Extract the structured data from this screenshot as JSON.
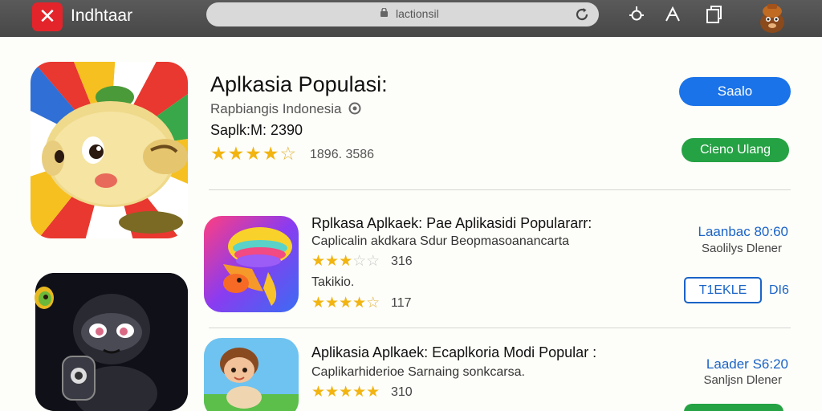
{
  "topbar": {
    "logo_glyph": "✕",
    "app_title": "Indhtaar",
    "url": "lactionsil"
  },
  "featured": {
    "title": "Aplkasia Populasi:",
    "subtitle": "Rapbiangis Indonesia",
    "size_text": "Saplk:M: 2390",
    "rating_stars": "★★★★",
    "rating_partial": "☆",
    "rating_count": "1896. 3586",
    "primary_button": "Saalo",
    "secondary_button": "Cieno Ulang"
  },
  "rows": [
    {
      "title": "Rplkasa Aplkaek: Pae Aplikasidi Populararr:",
      "subtitle": "Caplicalin akdkara Sdur Beopmasoanancarta",
      "stars": "★★★",
      "stars_empty": "☆☆",
      "rating": "316",
      "category": "Takikio.",
      "stars2": "★★★★",
      "stars2_empty": "☆",
      "rating2": "117",
      "price": "Laanbac 80:60",
      "meta": "Saolilys Dlener",
      "button": "T1EKLE",
      "extra": "DI6"
    },
    {
      "title": "Aplikasia Aplkaek: Ecaplkoria Modi Popular :",
      "subtitle": "Caplikarhiderioe Sarnaing sonkcarsa.",
      "stars": "★★★★★",
      "rating": "310",
      "price": "Laader S6:20",
      "meta": "Sanljsn Dlener"
    }
  ]
}
